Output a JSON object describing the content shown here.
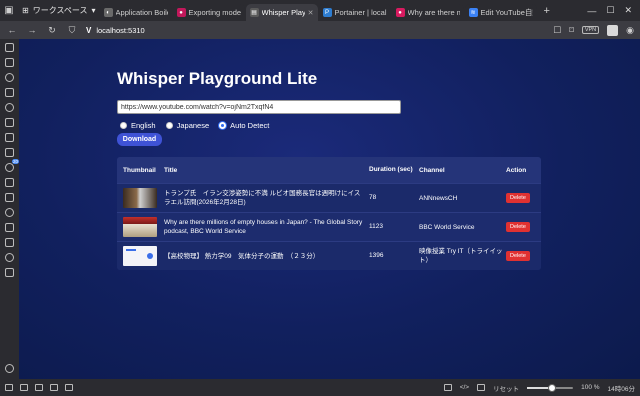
{
  "browser": {
    "workspace_label": "ワークスペース",
    "tabs": [
      {
        "label": "Application Boilerpl",
        "color": "#6a6a6a",
        "glyph": "◐"
      },
      {
        "label": "Exporting models - ",
        "color": "#c2185b",
        "glyph": "●"
      },
      {
        "label": "Whisper Playground L",
        "color": "#5a5a5a",
        "glyph": "▤"
      },
      {
        "label": "Portainer | local",
        "color": "#2e7dd1",
        "glyph": "P"
      },
      {
        "label": "Why are there millio",
        "color": "#d81b60",
        "glyph": "●"
      },
      {
        "label": "Edit YouTube自動文...",
        "color": "#3b82f6",
        "glyph": "≋"
      }
    ],
    "url": "localhost:5310",
    "vpn_label": "VPN"
  },
  "app": {
    "title": "Whisper Playground Lite",
    "url_input": {
      "value": "https://www.youtube.com/watch?v=ojNm2TxqfN4",
      "placeholder": ""
    },
    "language_options": [
      {
        "label": "English",
        "selected": false
      },
      {
        "label": "Japanese",
        "selected": false
      },
      {
        "label": "Auto Detect",
        "selected": true
      }
    ],
    "download_label": "Download",
    "table": {
      "headers": {
        "thumbnail": "Thumbnail",
        "title": "Title",
        "duration": "Duration (sec)",
        "channel": "Channel",
        "action": "Action"
      },
      "rows": [
        {
          "title": "トランプ氏　イラン交渉姿勢に不満 ルビオ国務長官は週明けにイスラエル訪問(2026年2月28日)",
          "duration": "78",
          "channel": "ANNnewsCH",
          "action": "Delete"
        },
        {
          "title": "Why are there millions of empty houses in Japan? - The Global Story podcast, BBC World Service",
          "duration": "1123",
          "channel": "BBC World Service",
          "action": "Delete"
        },
        {
          "title": "【高校物理】 熱力学09　気体分子の運動　（２３分）",
          "duration": "1396",
          "channel": "映像授業 Try IT（トライイット）",
          "action": "Delete"
        }
      ]
    }
  },
  "status": {
    "reset_label": "リセット",
    "zoom": "100 %",
    "zoom_fraction": 0.55,
    "time": "14時06分"
  }
}
